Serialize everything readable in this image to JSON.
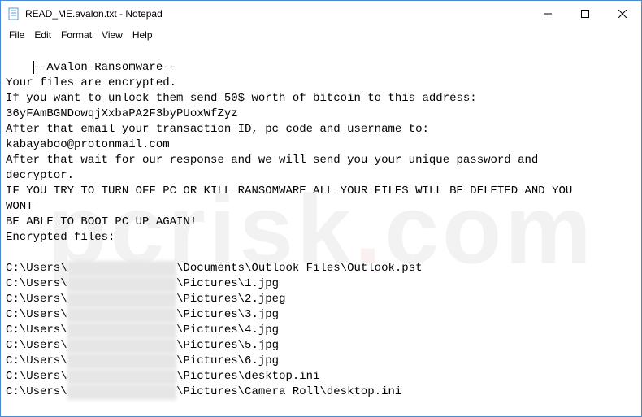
{
  "window": {
    "title": "READ_ME.avalon.txt - Notepad"
  },
  "menu": {
    "file": "File",
    "edit": "Edit",
    "format": "Format",
    "view": "View",
    "help": "Help"
  },
  "body": {
    "l1": "--Avalon Ransomware--",
    "l2": "Your files are encrypted.",
    "l3": "If you want to unlock them send 50$ worth of bitcoin to this address:",
    "l4": "36yFAmBGNDowqjXxbaPA2F3byPUoxWfZyz",
    "l5": "After that email your transaction ID, pc code and username to:",
    "l6": "kabayaboo@protonmail.com",
    "l7": "After that wait for our response and we will send you your unique password and",
    "l8": "decryptor.",
    "l9": "IF YOU TRY TO TURN OFF PC OR KILL RANSOMWARE ALL YOUR FILES WILL BE DELETED AND YOU",
    "l10": "WONT",
    "l11": "BE ABLE TO BOOT PC UP AGAIN!",
    "l12": "Encrypted files:",
    "blank": "",
    "prefix": "C:\\Users\\",
    "redacted": "████████████████",
    "suffix1": "\\Documents\\Outlook Files\\Outlook.pst",
    "suffix2": "\\Pictures\\1.jpg",
    "suffix3": "\\Pictures\\2.jpeg",
    "suffix4": "\\Pictures\\3.jpg",
    "suffix5": "\\Pictures\\4.jpg",
    "suffix6": "\\Pictures\\5.jpg",
    "suffix7": "\\Pictures\\6.jpg",
    "suffix8": "\\Pictures\\desktop.ini",
    "suffix9": "\\Pictures\\Camera Roll\\desktop.ini"
  },
  "watermark": {
    "left": "pcrisk",
    "dot": ".",
    "right": "com"
  }
}
